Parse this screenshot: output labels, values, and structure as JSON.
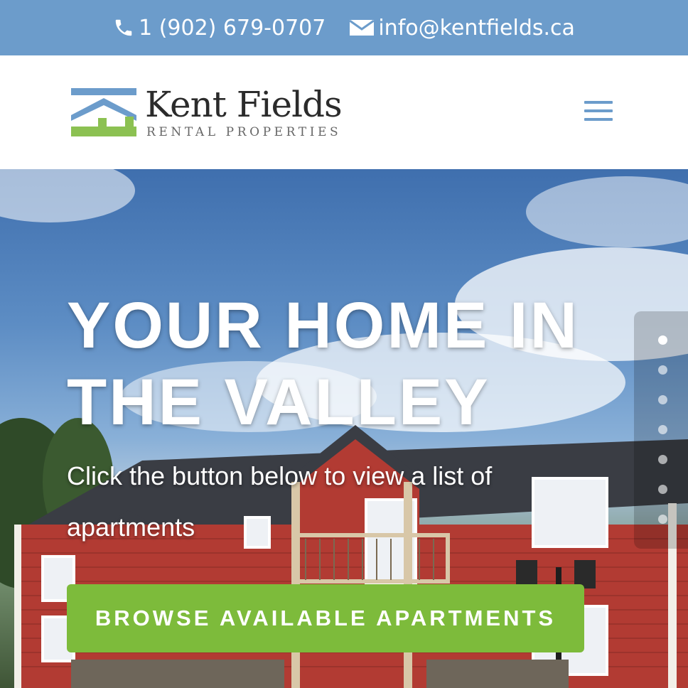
{
  "topbar": {
    "phone": "1 (902) 679-0707",
    "email": "info@kentfields.ca",
    "phone_icon": "phone-icon",
    "email_icon": "envelope-icon"
  },
  "header": {
    "logo_title": "Kent Fields",
    "logo_subtitle": "RENTAL PROPERTIES",
    "menu_icon": "hamburger-menu-icon"
  },
  "hero": {
    "title": "YOUR HOME IN THE VALLEY",
    "subtitle": "Click the button below to view a list of apartments",
    "button_label": "BROWSE AVAILABLE APARTMENTS",
    "slides_count": 7,
    "active_slide": 1
  },
  "colors": {
    "topbar": "#6c9ccb",
    "accent_green": "#7dbb3b",
    "logo_blue": "#6c9ccb",
    "logo_green": "#8cc152"
  }
}
